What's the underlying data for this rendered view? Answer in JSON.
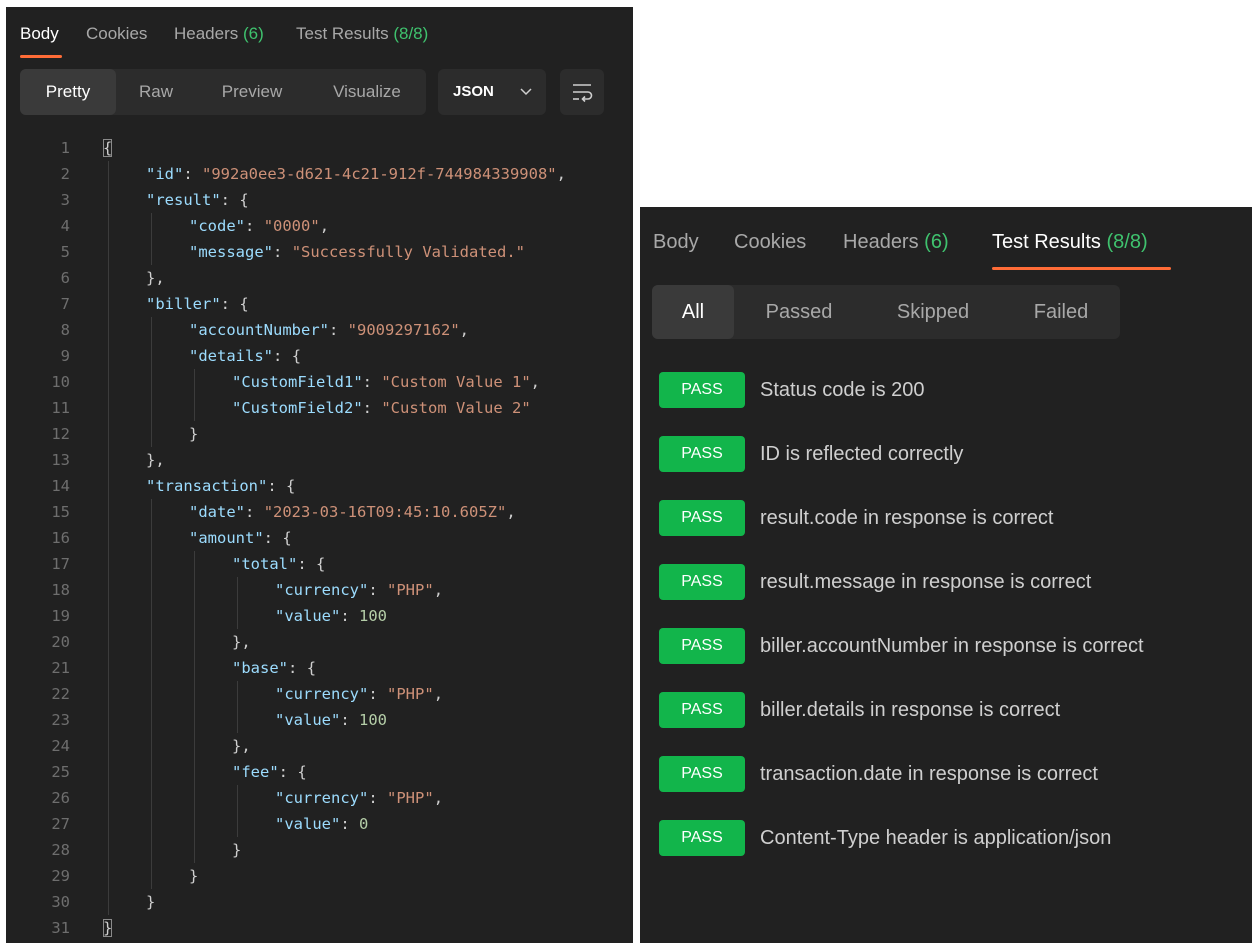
{
  "left_panel": {
    "tabs": [
      {
        "label": "Body",
        "count": ""
      },
      {
        "label": "Cookies",
        "count": ""
      },
      {
        "label": "Headers",
        "count": "(6)"
      },
      {
        "label": "Test Results",
        "count": "(8/8)"
      }
    ],
    "active_tab": "Body",
    "view_modes": [
      "Pretty",
      "Raw",
      "Preview",
      "Visualize"
    ],
    "active_view_mode": "Pretty",
    "format": "JSON",
    "wrap_icon": "wrap-lines-icon",
    "code_lines": [
      "{",
      "\"id\": \"992a0ee3-d621-4c21-912f-744984339908\",",
      "\"result\": {",
      "\"code\": \"0000\",",
      "\"message\": \"Successfully Validated.\"",
      "},",
      "\"biller\": {",
      "\"accountNumber\": \"9009297162\",",
      "\"details\": {",
      "\"CustomField1\": \"Custom Value 1\",",
      "\"CustomField2\": \"Custom Value 2\"",
      "}",
      "},",
      "\"transaction\": {",
      "\"date\": \"2023-03-16T09:45:10.605Z\",",
      "\"amount\": {",
      "\"total\": {",
      "\"currency\": \"PHP\",",
      "\"value\": 100",
      "},",
      "\"base\": {",
      "\"currency\": \"PHP\",",
      "\"value\": 100",
      "},",
      "\"fee\": {",
      "\"currency\": \"PHP\",",
      "\"value\": 0",
      "}",
      "}",
      "}",
      "}"
    ],
    "code_indent": [
      0,
      1,
      1,
      2,
      2,
      1,
      1,
      2,
      2,
      3,
      3,
      2,
      1,
      1,
      2,
      2,
      3,
      4,
      4,
      3,
      3,
      4,
      4,
      3,
      3,
      4,
      4,
      3,
      2,
      1,
      0
    ]
  },
  "right_panel": {
    "tabs": [
      {
        "label": "Body",
        "count": ""
      },
      {
        "label": "Cookies",
        "count": ""
      },
      {
        "label": "Headers",
        "count": "(6)"
      },
      {
        "label": "Test Results",
        "count": "(8/8)"
      }
    ],
    "active_tab": "Test Results",
    "filters": [
      "All",
      "Passed",
      "Skipped",
      "Failed"
    ],
    "active_filter": "All",
    "status_color": "#12b54b",
    "accent_color": "#ff6c37",
    "results": [
      {
        "status": "PASS",
        "name": "Status code is 200"
      },
      {
        "status": "PASS",
        "name": "ID is reflected correctly"
      },
      {
        "status": "PASS",
        "name": "result.code in response is correct"
      },
      {
        "status": "PASS",
        "name": "result.message in response is correct"
      },
      {
        "status": "PASS",
        "name": "biller.accountNumber in response is correct"
      },
      {
        "status": "PASS",
        "name": "biller.details in response is correct"
      },
      {
        "status": "PASS",
        "name": "transaction.date in response is correct"
      },
      {
        "status": "PASS",
        "name": "Content-Type header is application/json"
      }
    ]
  }
}
